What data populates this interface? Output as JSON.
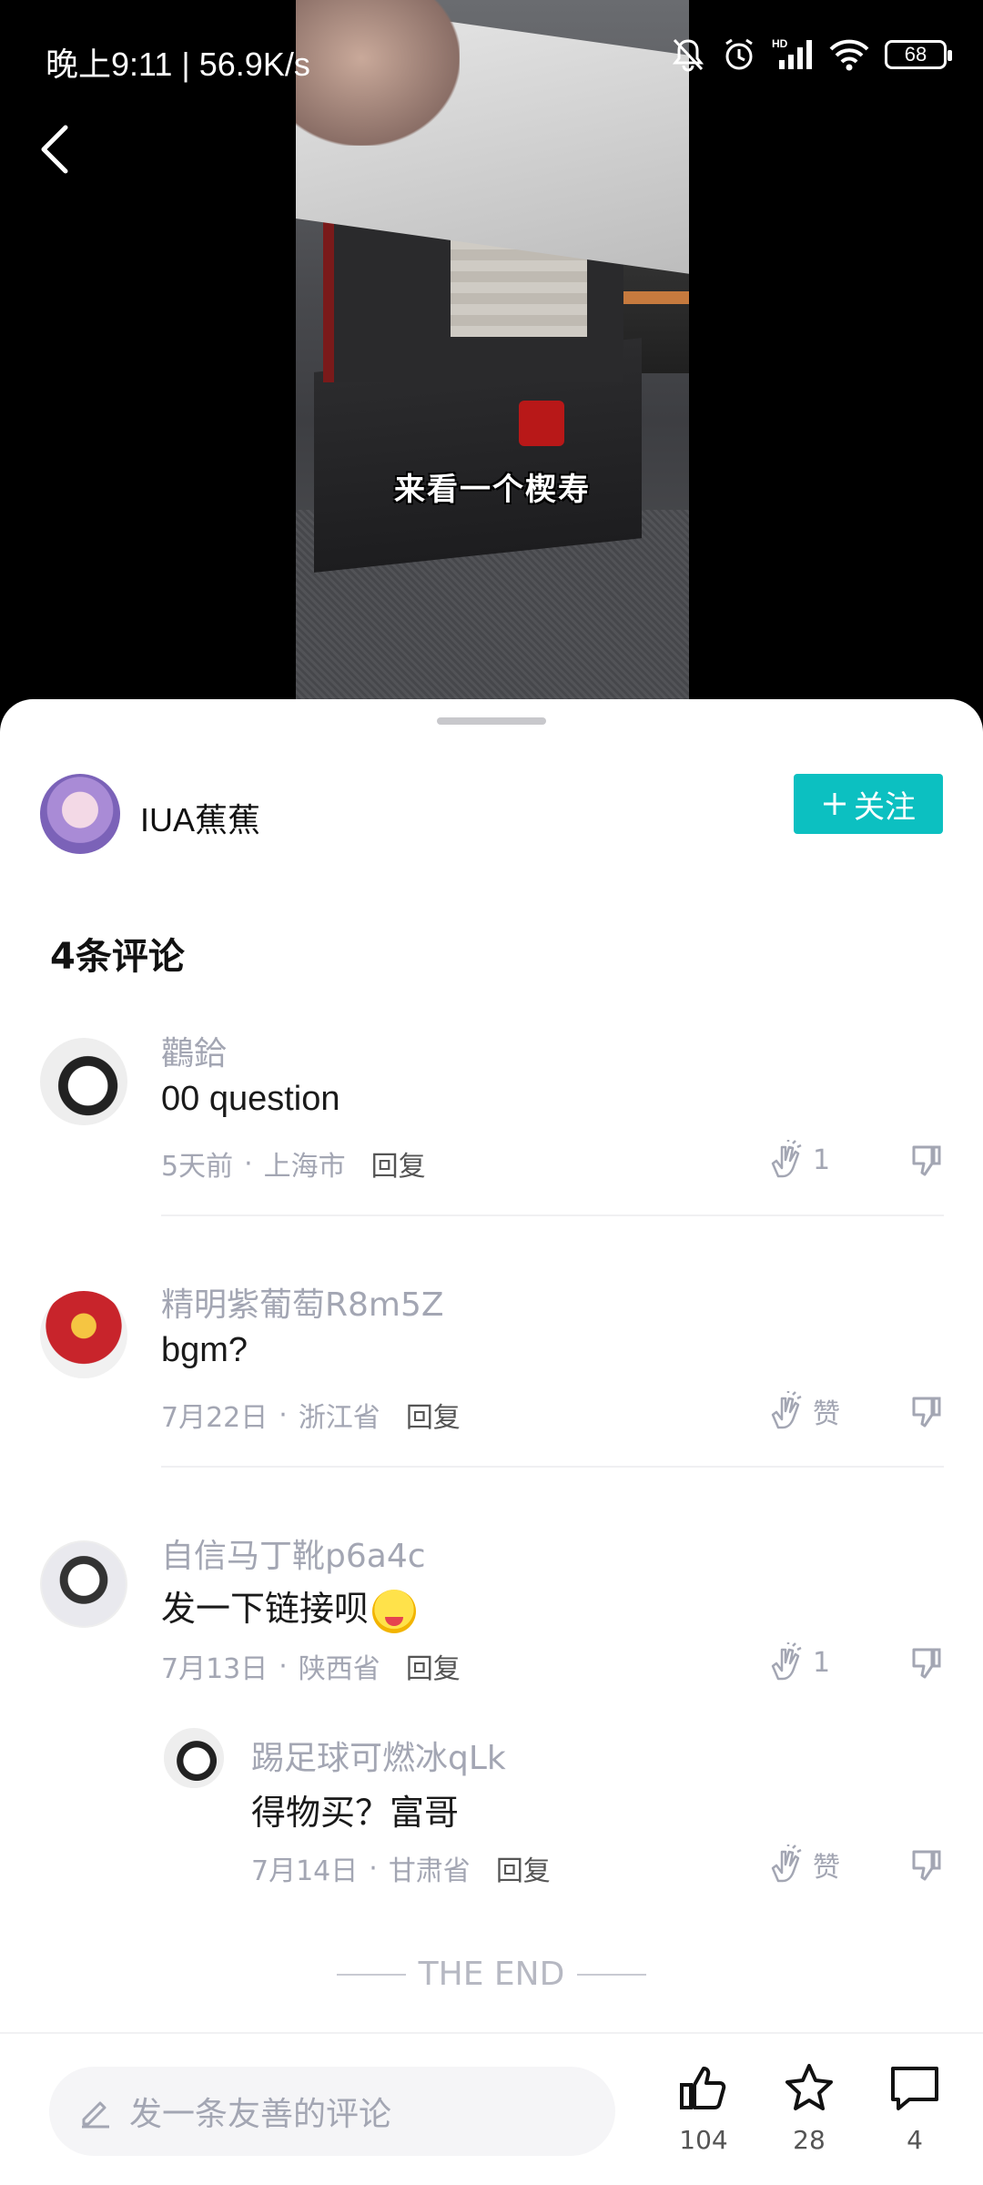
{
  "status_bar": {
    "time": "晚上9:11 | 56.9K/s",
    "battery": "68"
  },
  "video": {
    "subtitle": "来看一个楔寿"
  },
  "author": {
    "name": "IUA蕉蕉",
    "follow_label": "关注"
  },
  "comments_header": "4条评论",
  "comments": [
    {
      "user": "鸛鉿",
      "text": "00 question",
      "time": "5天前",
      "location": "上海市",
      "reply": "回复",
      "likes": "1"
    },
    {
      "user": "精明紫葡萄R8m5Z",
      "text": "bgm?",
      "time": "7月22日",
      "location": "浙江省",
      "reply": "回复",
      "likes": "赞"
    },
    {
      "user": "自信马丁靴p6a4c",
      "text": "发一下链接呗",
      "time": "7月13日",
      "location": "陕西省",
      "reply": "回复",
      "likes": "1",
      "replies": [
        {
          "user": "踢足球可燃冰qLk",
          "text": "得物买？富哥",
          "time": "7月14日",
          "location": "甘肃省",
          "reply": "回复",
          "likes": "赞"
        }
      ]
    }
  ],
  "separator_dot": "·",
  "end_label": "THE END",
  "bottom_bar": {
    "input_placeholder": "发一条友善的评论",
    "like_count": "104",
    "favorite_count": "28",
    "comment_count": "4"
  }
}
